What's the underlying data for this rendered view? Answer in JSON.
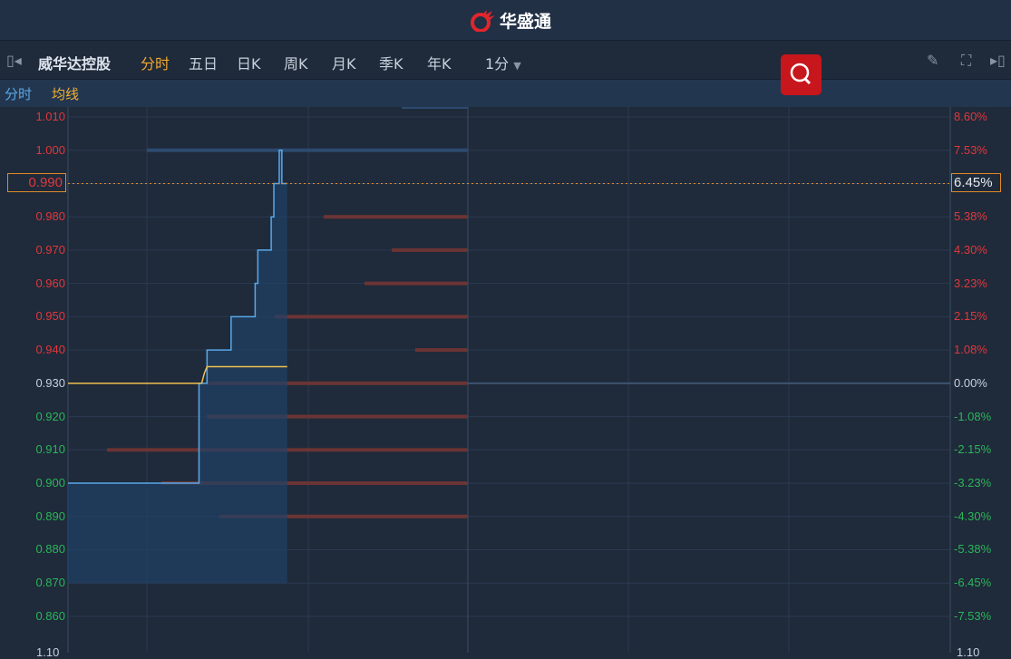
{
  "app": {
    "title": "华盛通"
  },
  "toolbar": {
    "stock_name": "威华达控股",
    "tabs": [
      "分时",
      "五日",
      "日K",
      "周K",
      "月K",
      "季K",
      "年K"
    ],
    "active_tab": "分时",
    "interval": "1分"
  },
  "legend": {
    "line": "分时",
    "avg": "均线"
  },
  "colors": {
    "up": "#e0383c",
    "down": "#2bb55a",
    "line": "#5aa8e8",
    "avg": "#f0c050",
    "accent": "#e08a2a"
  },
  "chart_data": {
    "type": "line",
    "prev_close": 0.93,
    "current_price": "0.990",
    "current_pct": "6.45%",
    "ylim": [
      0.855,
      1.012
    ],
    "xlim": [
      0,
      330
    ],
    "price_ticks": [
      "1.010",
      "1.000",
      "0.990",
      "0.980",
      "0.970",
      "0.960",
      "0.950",
      "0.940",
      "0.930",
      "0.920",
      "0.910",
      "0.900",
      "0.890",
      "0.880",
      "0.870",
      "0.860"
    ],
    "pct_ticks": [
      "8.60%",
      "7.53%",
      "6.45%",
      "5.38%",
      "4.30%",
      "3.23%",
      "2.15%",
      "1.08%",
      "0.00%",
      "-1.08%",
      "-2.15%",
      "-3.23%",
      "-4.30%",
      "-5.38%",
      "-6.45%",
      "-7.53%"
    ],
    "bottom_labels": [
      "1.10",
      "1.10"
    ],
    "price_series": [
      [
        0,
        0.9
      ],
      [
        48,
        0.9
      ],
      [
        49,
        0.93
      ],
      [
        51,
        0.93
      ],
      [
        52,
        0.94
      ],
      [
        60,
        0.94
      ],
      [
        61,
        0.95
      ],
      [
        68,
        0.95
      ],
      [
        70,
        0.96
      ],
      [
        71,
        0.97
      ],
      [
        75,
        0.97
      ],
      [
        76,
        0.98
      ],
      [
        77,
        0.99
      ],
      [
        78,
        0.99
      ],
      [
        79,
        1.0
      ],
      [
        80,
        0.99
      ],
      [
        82,
        0.99
      ]
    ],
    "avg_series": [
      [
        0,
        0.93
      ],
      [
        50,
        0.93
      ],
      [
        51,
        0.933
      ],
      [
        52,
        0.935
      ],
      [
        82,
        0.935
      ]
    ],
    "depth_levels": [
      {
        "price": 1.013,
        "size": 73,
        "side": "ask"
      },
      {
        "price": 1.0,
        "size": 354,
        "side": "ask"
      },
      {
        "price": 0.98,
        "size": 159,
        "side": "bid"
      },
      {
        "price": 0.97,
        "size": 84,
        "side": "bid"
      },
      {
        "price": 0.96,
        "size": 114,
        "side": "bid"
      },
      {
        "price": 0.95,
        "size": 213,
        "side": "bid"
      },
      {
        "price": 0.94,
        "size": 58,
        "side": "bid"
      },
      {
        "price": 0.93,
        "size": 288,
        "side": "bid"
      },
      {
        "price": 0.92,
        "size": 288,
        "side": "bid"
      },
      {
        "price": 0.91,
        "size": 398,
        "side": "bid"
      },
      {
        "price": 0.9,
        "size": 338,
        "side": "bid"
      },
      {
        "price": 0.89,
        "size": 274,
        "side": "bid"
      }
    ]
  }
}
